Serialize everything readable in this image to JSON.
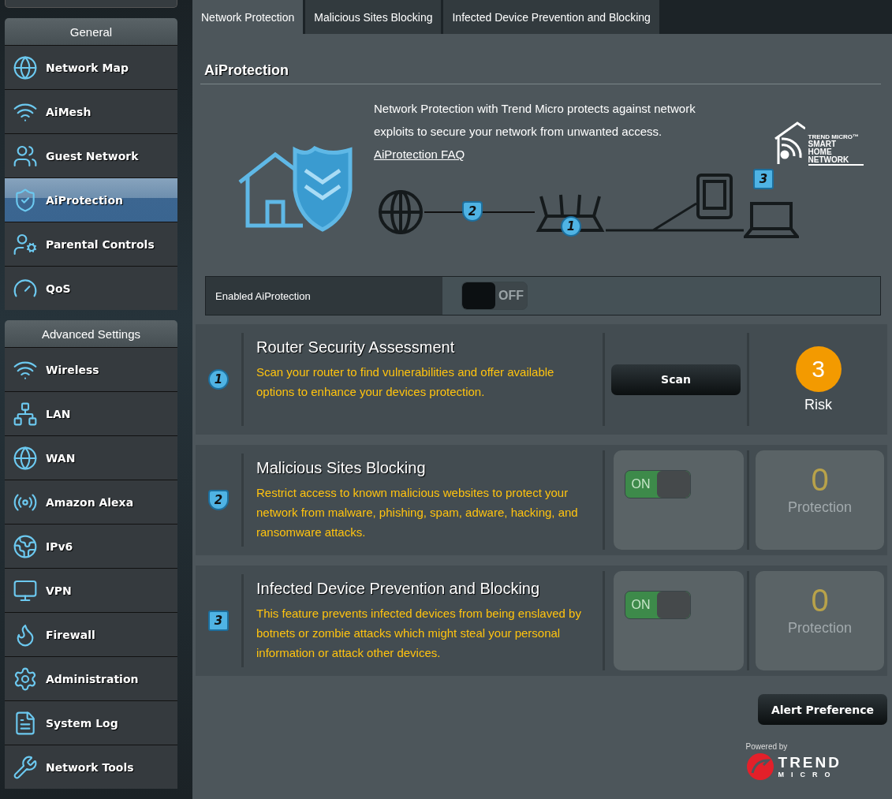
{
  "sidebar": {
    "sections": [
      {
        "title": "General",
        "items": [
          {
            "label": "Network Map",
            "selected": false
          },
          {
            "label": "AiMesh",
            "selected": false
          },
          {
            "label": "Guest Network",
            "selected": false
          },
          {
            "label": "AiProtection",
            "selected": true
          },
          {
            "label": "Parental Controls",
            "selected": false
          },
          {
            "label": "QoS",
            "selected": false
          }
        ]
      },
      {
        "title": "Advanced Settings",
        "items": [
          {
            "label": "Wireless",
            "selected": false
          },
          {
            "label": "LAN",
            "selected": false
          },
          {
            "label": "WAN",
            "selected": false
          },
          {
            "label": "Amazon Alexa",
            "selected": false
          },
          {
            "label": "IPv6",
            "selected": false
          },
          {
            "label": "VPN",
            "selected": false
          },
          {
            "label": "Firewall",
            "selected": false
          },
          {
            "label": "Administration",
            "selected": false
          },
          {
            "label": "System Log",
            "selected": false
          },
          {
            "label": "Network Tools",
            "selected": false
          }
        ]
      }
    ]
  },
  "tabs": [
    {
      "label": "Network Protection",
      "selected": true
    },
    {
      "label": "Malicious Sites Blocking",
      "selected": false
    },
    {
      "label": "Infected Device Prevention and Blocking",
      "selected": false
    }
  ],
  "page": {
    "title": "AiProtection",
    "description": "Network Protection with Trend Micro protects against network exploits to secure your network from unwanted access.",
    "faq_link": "AiProtection FAQ",
    "partner_logo": [
      "TREND MICRO™",
      "SMART",
      "HOME",
      "NETWORK"
    ]
  },
  "diagram": {
    "badges": [
      "2",
      "1",
      "3"
    ]
  },
  "enable": {
    "label": "Enabled AiProtection",
    "on": false,
    "switch_text": "OFF"
  },
  "features": [
    {
      "kind": "scan",
      "badge": "1",
      "title": "Router Security Assessment",
      "description": "Scan your router to find vulnerabilities and offer available options to enhance your devices protection.",
      "button": "Scan",
      "count": "3",
      "count_label": "Risk"
    },
    {
      "kind": "toggle",
      "badge": "2",
      "title": "Malicious Sites Blocking",
      "description": "Restrict access to known malicious websites to protect your network from malware, phishing, spam, adware, hacking, and ransomware attacks.",
      "on": true,
      "switch_text": "ON",
      "count": "0",
      "count_label": "Protection"
    },
    {
      "kind": "toggle",
      "badge": "3",
      "title": "Infected Device Prevention and Blocking",
      "description": "This feature prevents infected devices from being enslaved by botnets or zombie attacks which might steal your personal information or attack other devices.",
      "on": true,
      "switch_text": "ON",
      "count": "0",
      "count_label": "Protection"
    }
  ],
  "alert_button": "Alert Preference",
  "footer": {
    "powered_by": "Powered by",
    "brand": [
      "TREND",
      "MICRO"
    ]
  }
}
